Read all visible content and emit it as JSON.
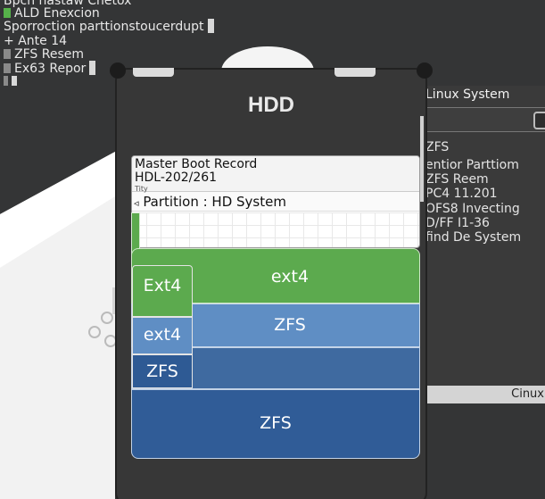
{
  "terminal": {
    "lines": [
      "Bpcn nastaw  Cnetox",
      "ALD Enexcion",
      "Sporroction parttionstoucerdupt",
      "Ante 14",
      "ZFS Resem",
      "Ex63 Repor"
    ]
  },
  "panel": {
    "title": "HDD"
  },
  "card": {
    "line1": "Master Boot Record",
    "line2": "HDL-202/261",
    "line3": "Tity",
    "partition_row": "Partition :  HD System",
    "arrow": "◃"
  },
  "partitions": [
    {
      "label": "ext4"
    },
    {
      "label": "ZFS"
    },
    {
      "label": "ZFS"
    }
  ],
  "mini_blocks": [
    {
      "label": "Ext4"
    },
    {
      "label": "ext4"
    },
    {
      "label": "ZFS"
    }
  ],
  "side_window": {
    "title": "Linux System",
    "lines": [
      "ZFS",
      "entior Parttiom",
      "ZFS Reem",
      "PC4 11.201",
      "OFS8 Invecting",
      "D/FF I1-36",
      "find De System"
    ],
    "footer": "Cinux"
  },
  "colors": {
    "green": "#5caa4e",
    "blue_light": "#5f8ec4",
    "blue_dark": "#305c97",
    "panel": "#373737"
  }
}
